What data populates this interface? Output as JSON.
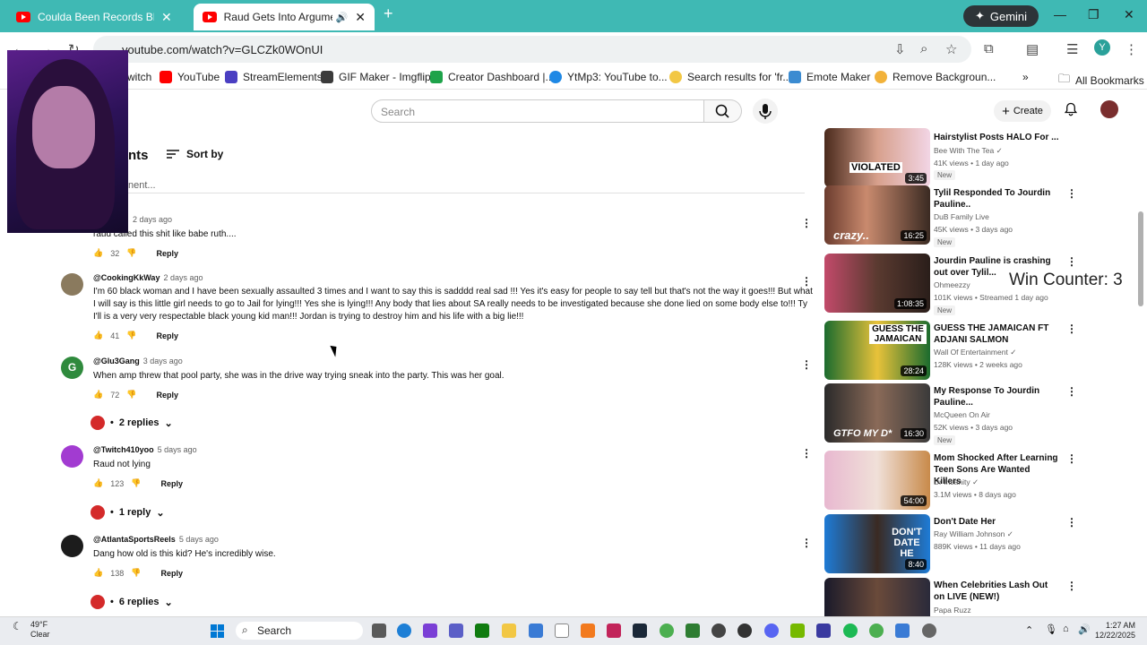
{
  "browser": {
    "tabs": [
      {
        "title": "Coulda Been Records BROOKLY",
        "active": false
      },
      {
        "title": "Raud Gets Into Argument W",
        "active": true
      }
    ],
    "gemini_label": "Gemini",
    "url": "youtube.com/watch?v=GLCZk0WOnUI",
    "bookmarks": [
      "witch",
      "YouTube",
      "StreamElements",
      "GIF Maker - Imgflip",
      "Creator Dashboard |...",
      "YtMp3: YouTube to...",
      "Search results for 'fr...",
      "Emote Maker",
      "Remove Backgroun..."
    ],
    "all_bookmarks": "All Bookmarks",
    "profile_initial": "Y"
  },
  "youtube": {
    "search_placeholder": "Search",
    "create_label": "Create",
    "comments_header": "nts",
    "sort_by": "Sort by",
    "add_comment_placeholder": "nent...",
    "comments": [
      {
        "handle": "",
        "time": "2 days ago",
        "text": "raud called this shit like babe ruth....",
        "likes": "32",
        "reply": "Reply"
      },
      {
        "handle": "@CookingKkWay",
        "time": "2 days ago",
        "text": "I'm 60 black woman and I have been sexually assaulted 3 times and I want to say this is sadddd real sad !!! Yes it's easy for people to say tell but that's not the way it goes!!!  But what I will say is this little girl needs to go to Jail for lying!!! Yes she is lying!!! Any body that lies about SA really needs to be investigated because she done lied on some body else to!!! Ty I'll is a very very respectable black young kid man!!! Jordan is trying to destroy him and his life with a big lie!!!",
        "likes": "41",
        "reply": "Reply"
      },
      {
        "handle": "@Glu3Gang",
        "time": "3 days ago",
        "text": "When amp threw that pool party, she was in the drive way trying sneak into the party. This was her goal.",
        "likes": "72",
        "reply": "Reply",
        "replies": "2 replies",
        "avatar_letter": "G"
      },
      {
        "handle": "@Twitch410yoo",
        "time": "5 days ago",
        "text": "Raud not lying",
        "likes": "123",
        "reply": "Reply",
        "replies": "1 reply"
      },
      {
        "handle": "@AtlantaSportsReels",
        "time": "5 days ago",
        "text": "Dang how old is this kid? He's incredibly wise.",
        "likes": "138",
        "reply": "Reply",
        "replies": "6 replies"
      }
    ],
    "sidebar": [
      {
        "title": "Hairstylist Posts HALO For ...",
        "channel": "Bee With The Tea",
        "meta": "41K views • 1 day ago",
        "badge": "New",
        "duration": "3:45",
        "thumb_text": "VIOLATED"
      },
      {
        "title": "Tylil Responded To Jourdin Pauline..",
        "channel": "DuB Family Live",
        "meta": "45K views • 3 days ago",
        "badge": "New",
        "duration": "16:25",
        "thumb_text": "crazy.."
      },
      {
        "title": "Jourdin Pauline is crashing out over Tylil...",
        "channel": "Ohmeezzy",
        "meta": "101K views • Streamed 1 day ago",
        "badge": "New",
        "duration": "1:08:35",
        "thumb_text": ""
      },
      {
        "title": "GUESS THE JAMAICAN FT ADJANI SALMON",
        "channel": "Wall Of Entertainment",
        "meta": "128K views • 2 weeks ago",
        "badge": "",
        "duration": "28:24",
        "thumb_text": "GUESS THE JAMAICAN"
      },
      {
        "title": "My Response To Jourdin Pauline...",
        "channel": "McQueen On Air",
        "meta": "52K views • 3 days ago",
        "badge": "New",
        "duration": "16:30",
        "thumb_text": "GTFO MY D*"
      },
      {
        "title": "Mom Shocked After Learning Teen Sons Are Wanted Killers",
        "channel": "Dr Insanity",
        "meta": "3.1M views • 8 days ago",
        "badge": "",
        "duration": "54:00",
        "thumb_text": ""
      },
      {
        "title": "Don't Date Her",
        "channel": "Ray William Johnson",
        "meta": "889K views • 11 days ago",
        "badge": "",
        "duration": "8:40",
        "thumb_text": "DON'T DATE HE"
      },
      {
        "title": "When Celebrities Lash Out on LIVE (NEW!)",
        "channel": "Papa Ruzz",
        "meta": "",
        "badge": "",
        "duration": "",
        "thumb_text": ""
      }
    ]
  },
  "overlay": {
    "win_counter": "Win Counter: 3"
  },
  "taskbar": {
    "temp": "49°F",
    "condition": "Clear",
    "search_label": "Search",
    "time": "1:27 AM",
    "date": "12/22/2025"
  }
}
